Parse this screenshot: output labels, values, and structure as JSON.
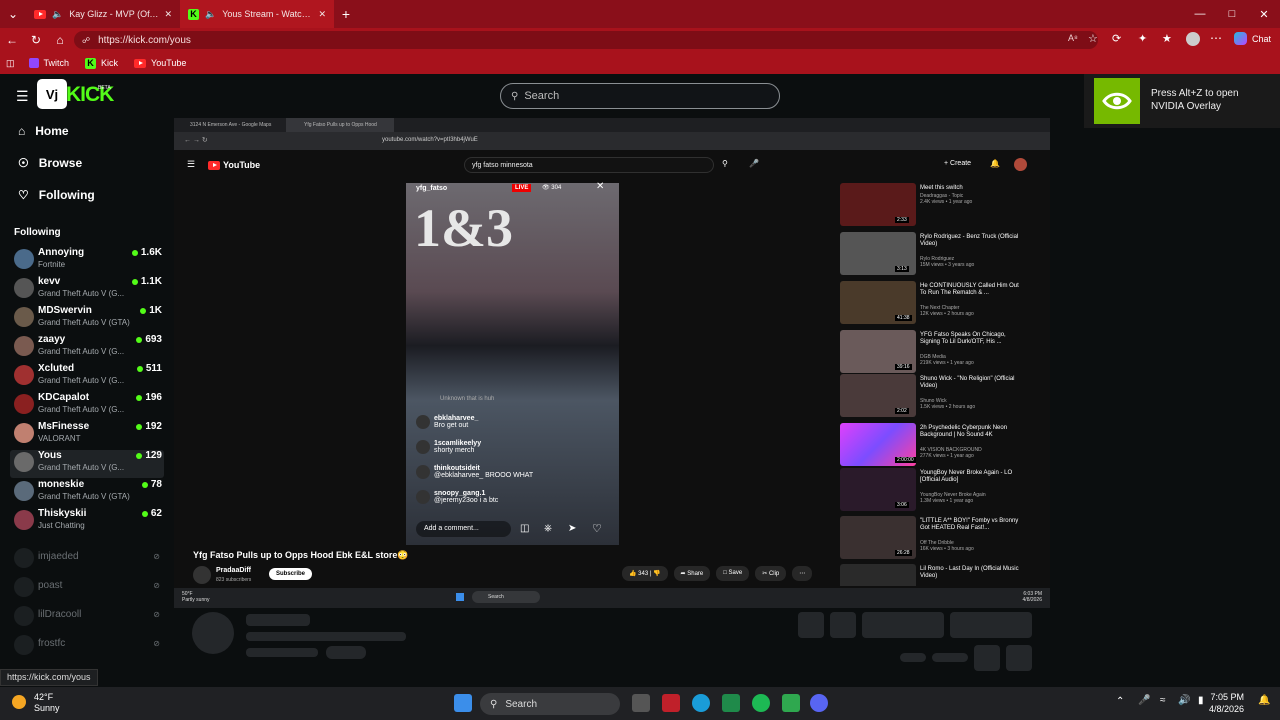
{
  "browser": {
    "tabs": [
      {
        "title": "Kay Glizz - MVP (Official Mus",
        "active": false
      },
      {
        "title": "Yous Stream - Watch Live on K",
        "active": true
      }
    ],
    "new_tab_symbol": "+",
    "url": "https://kick.com/yous",
    "bookmarks": [
      {
        "label": "Twitch"
      },
      {
        "label": "Kick"
      },
      {
        "label": "YouTube"
      }
    ],
    "chat_label": "Chat"
  },
  "kick": {
    "logo_text": "KICK",
    "beta_label": "BETA",
    "search_placeholder": "Search",
    "nav": [
      {
        "label": "Home",
        "icon": "home-icon"
      },
      {
        "label": "Browse",
        "icon": "compass-icon"
      },
      {
        "label": "Following",
        "icon": "heart-icon"
      }
    ],
    "following_header": "Following",
    "following": [
      {
        "name": "Annoying",
        "game": "Fortnite",
        "viewers": "1.6K"
      },
      {
        "name": "kevv",
        "game": "Grand Theft Auto V (G...",
        "viewers": "1.1K"
      },
      {
        "name": "MDSwervin",
        "game": "Grand Theft Auto V (GTA)",
        "viewers": "1K"
      },
      {
        "name": "zaayy",
        "game": "Grand Theft Auto V (G...",
        "viewers": "693"
      },
      {
        "name": "Xcluted",
        "game": "Grand Theft Auto V (G...",
        "viewers": "511"
      },
      {
        "name": "KDCapalot",
        "game": "Grand Theft Auto V (G...",
        "viewers": "196"
      },
      {
        "name": "MsFinesse",
        "game": "VALORANT",
        "viewers": "192"
      },
      {
        "name": "Yous",
        "game": "Grand Theft Auto V (G...",
        "viewers": "129"
      },
      {
        "name": "moneskie",
        "game": "Grand Theft Auto V (GTA)",
        "viewers": "78"
      },
      {
        "name": "Thiskyskii",
        "game": "Just Chatting",
        "viewers": "62"
      }
    ],
    "offline": [
      {
        "name": "imjaeded"
      },
      {
        "name": "poast"
      },
      {
        "name": "lilDracooll"
      },
      {
        "name": "frostfc"
      }
    ],
    "status_url": "https://kick.com/yous"
  },
  "stream": {
    "inner_tabs": [
      "3124 N Emerson Ave - Google Maps",
      "Yfg Fatso Pulls up to Opps Hood"
    ],
    "inner_url": "youtube.com/watch?v=ptI3hb4jWuE",
    "yt_logo": "YouTube",
    "yt_search": "yfg fatso minnesota",
    "yt_create": "Create",
    "short_user": "yfg_fatso",
    "live_badge": "LIVE",
    "live_viewers": "304",
    "short_sign": "1&3",
    "comments": [
      {
        "user": "ebklaharvee_",
        "text": "Bro get out"
      },
      {
        "user": "1scamlikeelyy",
        "text": "shorty merch"
      },
      {
        "user": "thinkoutsideit",
        "text": "@ebklaharvee_ BROOO WHAT"
      },
      {
        "user": "snoopy_gang.1",
        "text": "@jeremy23oo i a btc"
      }
    ],
    "faded_comment": "Unknown that is huh",
    "comment_placeholder": "Add a comment...",
    "video_title": "Yfg Fatso Pulls up to Opps Hood Ebk E&L store😳",
    "channel": "PradaaDiff",
    "subscribers": "823 subscribers",
    "subscribe": "Subscribe",
    "likes": "343",
    "share": "Share",
    "save": "Save",
    "clip": "Clip",
    "recommendations": [
      {
        "title": "Meet this switch",
        "meta": "Deadraggas - Topic\n2.4K views • 1 year ago",
        "duration": "2:33"
      },
      {
        "title": "Rylo Rodriguez - Benz Truck (Official Video)",
        "meta": "Rylo Rodriguez\n15M views • 3 years ago",
        "duration": "3:13"
      },
      {
        "title": "He CONTINUOUSLY Called Him Out To Run The Rematch & ...",
        "meta": "The Next Chapter\n12K views • 2 hours ago",
        "duration": "41:38"
      },
      {
        "title": "YFG Fatso Speaks On Chicago, Signing To Lil Durk/OTF, His ...",
        "meta": "DGB Media\n219K views • 1 year ago",
        "duration": "39:16"
      },
      {
        "title": "Shuno Wick - \"No Religion\" (Official Video)",
        "meta": "Shuno Wick\n1.5K views • 2 hours ago",
        "duration": "2:02"
      },
      {
        "title": "2h Psychedelic Cyberpunk Neon Background | No Sound 4K",
        "meta": "4K VISION BACKGROUND\n277K views • 1 year ago",
        "duration": "2:00:00"
      },
      {
        "title": "YoungBoy Never Broke Again - LO [Official Audio]",
        "meta": "YoungBoy Never Broke Again\n1.3M views • 1 year ago",
        "duration": "3:06"
      },
      {
        "title": "\"LITTLE A** BOY!\" Fomby vs Bronny Got HEATED Real Fast!...",
        "meta": "Off The Dribble\n16K views • 3 hours ago",
        "duration": "26:28"
      },
      {
        "title": "Lil Romo - Last Day In (Official Music Video)",
        "meta": "",
        "duration": ""
      }
    ],
    "inner_weather": "50°F",
    "inner_weather_desc": "Partly sunny",
    "inner_search": "Search",
    "inner_time": "6:03 PM",
    "inner_date": "4/8/2026"
  },
  "nvidia": {
    "message": "Press Alt+Z to open NVIDIA Overlay"
  },
  "taskbar": {
    "weather_temp": "42°F",
    "weather_desc": "Sunny",
    "search": "Search",
    "time": "7:05 PM",
    "date": "4/8/2026"
  }
}
